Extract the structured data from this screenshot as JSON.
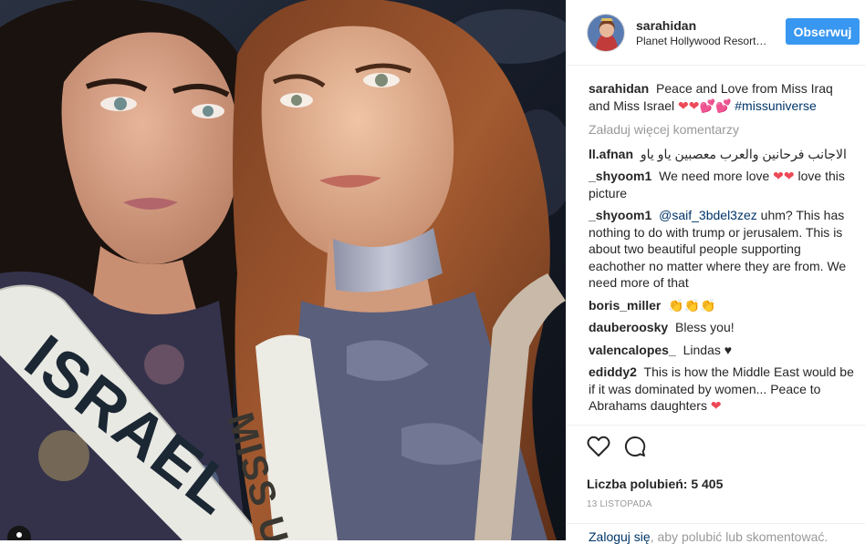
{
  "header": {
    "username": "sarahidan",
    "location": "Planet Hollywood Resort & Casino",
    "follow_label": "Obserwuj"
  },
  "photo": {
    "sash_left": "ISRAEL",
    "sash_right": "MISS U"
  },
  "caption": {
    "user": "sarahidan",
    "text": "Peace and Love from Miss Iraq and Miss Israel",
    "emoji": "❤❤💕💕",
    "hashtag": "#missuniverse"
  },
  "load_more_label": "Załaduj więcej komentarzy",
  "comments": [
    {
      "user": "ll.afnan",
      "text": "الاجانب فرحانين والعرب معصبين ياو ياو"
    },
    {
      "user": "_shyoom1",
      "text": "We need more love",
      "emoji": "❤❤",
      "text2": "love this picture"
    },
    {
      "user": "_shyoom1",
      "mention": "@saif_3bdel3zez",
      "text": "uhm? This has nothing to do with trump or jerusalem. This is about two beautiful people supporting eachother no matter where they are from. We need more of that"
    },
    {
      "user": "boris_miller",
      "emoji": "👏👏👏"
    },
    {
      "user": "dauberoosky",
      "text": "Bless you!"
    },
    {
      "user": "valencalopes_",
      "text": "Lindas",
      "emoji": "♥"
    },
    {
      "user": "ediddy2",
      "text": "This is how the Middle East would be if it was dominated by women... Peace to Abrahams daughters",
      "emoji": "❤"
    }
  ],
  "actions": {
    "like_icon": "heart-outline-icon",
    "comment_icon": "speech-bubble-icon"
  },
  "likes": {
    "label": "Liczba polubień:",
    "count": "5 405"
  },
  "date": "13 listopada",
  "login": {
    "link": "Zaloguj się",
    "text": ", aby polubić lub skomentować."
  },
  "colors": {
    "accent": "#3897f0",
    "link": "#003569",
    "muted": "#999999",
    "heart": "#ed4956"
  }
}
